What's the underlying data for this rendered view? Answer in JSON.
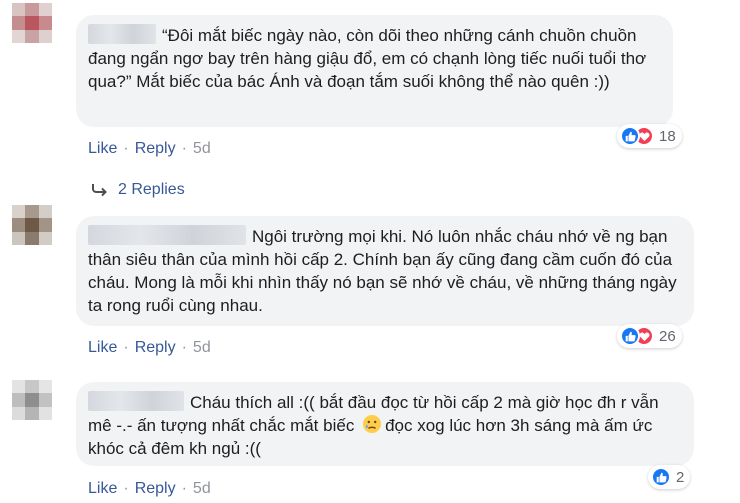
{
  "comments": [
    {
      "text": "“Đôi mắt biếc ngày nào, còn dõi theo những cánh chuồn chuồn đang ngẩn ngơ bay trên hàng giậu đổ, em có chạnh lòng tiếc nuối tuổi thơ qua?” Mắt biếc của bác Ánh và đoạn tắm suối không thể nào quên :))",
      "reaction_count": "18",
      "like_label": "Like",
      "reply_label": "Reply",
      "time": "5d",
      "replies_label": "2 Replies"
    },
    {
      "text": "Ngôi trường mọi khi. Nó luôn nhắc cháu nhớ về ng bạn thân siêu thân của mình hồi cấp 2. Chính bạn ấy cũng đang cầm cuốn đó của cháu. Mong là mỗi khi nhìn thấy nó bạn sẽ nhớ về cháu, về những tháng ngày ta rong ruổi cùng nhau.",
      "reaction_count": "26",
      "like_label": "Like",
      "reply_label": "Reply",
      "time": "5d"
    },
    {
      "text_before_emoji": "Cháu thích all :(( bắt đầu đọc từ hồi cấp 2 mà giờ học đh r vẫn mê -.- ấn tượng nhất chắc mắt biếc",
      "text_after_emoji": "đọc xog lúc hơn 3h sáng mà ấm ức khóc cả đêm kh ngủ :((",
      "reaction_count": "2",
      "like_label": "Like",
      "reply_label": "Reply",
      "time": "5d"
    }
  ],
  "colors": {
    "link": "#385898",
    "bubble": "#f2f3f5",
    "like_reaction": "#1877f2",
    "love_reaction": "#f33e58"
  }
}
